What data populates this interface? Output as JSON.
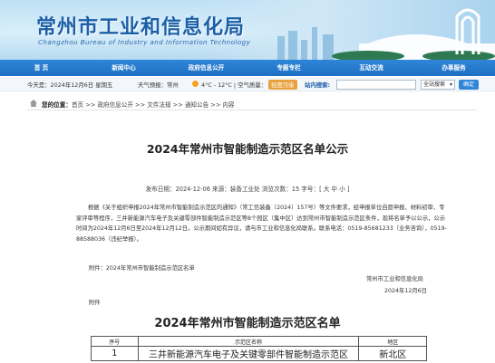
{
  "header": {
    "title": "常州市工业和信息化局",
    "subtitle": "Changzhou Bureau of Industry and Information Technology"
  },
  "nav": {
    "items": [
      "首 页",
      "新闻中心",
      "政府信息公开",
      "专题专栏",
      "互动交流",
      "办事服务"
    ]
  },
  "infobar": {
    "date": "今天是：2024年12月6日 星期五",
    "weather_label": "天气预报：",
    "weather_city": "常州",
    "temperature": "4°C - 12°C",
    "air_quality_label": "空气质量：",
    "air_quality_value": "轻度污染",
    "search_label": "站内搜索:",
    "search_value": "",
    "search_scope": "全站搜索",
    "search_button": "确定"
  },
  "breadcrumb": {
    "label": "您的位置：",
    "path": "首页 >> 政府信息公开 >> 文件法规 >> 通知公告 >> 内容"
  },
  "article": {
    "title": "2024年常州市智能制造示范区名单公示",
    "meta": "发布日期：2024-12-06  来源：装备工业处  浏览次数：15  字号：[ 大 中 小 ]",
    "body": "根据《关于组织申报2024年常州市智能制造示范区的通知》（常工信装备〔2024〕157号）等文件要求，经申报单位自愿申报、材料初审、专家评审等程序，三井新能源汽车电子及关键零部件智能制造示范区等8个园区（集中区）达到常州市智能制造示范区条件，现将名单予以公示，公示时间为2024年12月6日至2024年12月12日。公示期间如有异议，请与市工业和信息化局联系。联系电话：0519-85681233（业务咨询），0519-88588036（违纪举报）。",
    "attachment_line": "附件：2024年常州市智能制造示范区名单",
    "sign_org": "常州市工业和信息化局",
    "sign_date": "2024年12月6日",
    "attachment_label": "附件"
  },
  "list": {
    "title": "2024年常州市智能制造示范区名单",
    "headers": [
      "序号",
      "示范区名称",
      "地区"
    ],
    "rows": [
      [
        "1",
        "三井新能源汽车电子及关键零部件智能制造示范区",
        "新北区"
      ]
    ]
  },
  "colors": {
    "brand_blue": "#1b5fa8",
    "nav_blue": "#2f86d8",
    "aqi_orange": "#e9a13b"
  }
}
